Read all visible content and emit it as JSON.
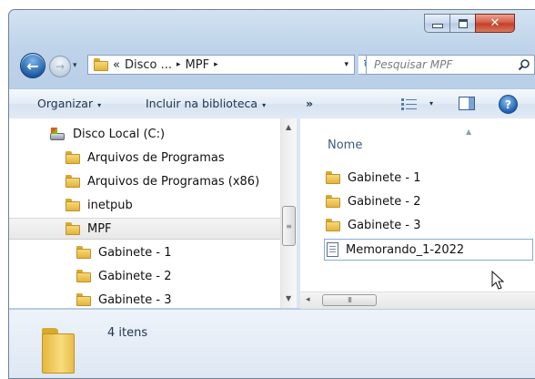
{
  "window": {
    "caption_buttons": {
      "minimize": "minimize-icon",
      "maximize": "maximize-icon",
      "close": "✕"
    }
  },
  "address_bar": {
    "overflow_marker": "«",
    "crumbs": [
      "Disco ...",
      "MPF"
    ],
    "crumb_separator": "▸",
    "dropdown_glyph": "▾"
  },
  "refresh_glyph": "↻",
  "search": {
    "placeholder": "Pesquisar MPF"
  },
  "toolbar": {
    "organize_label": "Organizar",
    "include_label": "Incluir na biblioteca",
    "more_label": "»",
    "dropdown_glyph": "▾",
    "help_glyph": "?"
  },
  "nav_tree": {
    "items": [
      {
        "label": "Disco Local (C:)",
        "icon": "drive-icon"
      },
      {
        "label": "Arquivos de Programas",
        "icon": "folder-icon"
      },
      {
        "label": "Arquivos de Programas (x86)",
        "icon": "folder-icon"
      },
      {
        "label": "inetpub",
        "icon": "folder-icon"
      },
      {
        "label": "MPF",
        "icon": "folder-icon",
        "selected": true
      },
      {
        "label": "Gabinete - 1",
        "icon": "folder-icon"
      },
      {
        "label": "Gabinete - 2",
        "icon": "folder-icon"
      },
      {
        "label": "Gabinete - 3",
        "icon": "folder-icon"
      }
    ]
  },
  "file_list": {
    "column_header": "Nome",
    "items": [
      {
        "label": "Gabinete - 1",
        "icon": "folder-icon"
      },
      {
        "label": "Gabinete - 2",
        "icon": "folder-icon"
      },
      {
        "label": "Gabinete - 3",
        "icon": "folder-icon"
      },
      {
        "label": "Memorando_1-2022",
        "icon": "text-document-icon",
        "focused": true
      }
    ]
  },
  "scrollbars": {
    "thumb_grip": "≡",
    "h_thumb_grip": "III",
    "up": "▲",
    "down": "▼",
    "left": "◂"
  },
  "details": {
    "count_text": "4 itens"
  },
  "colors": {
    "accent": "#2b6fc2",
    "selection_border": "#84acdd",
    "folder": "#e4b43a",
    "close": "#c13e27"
  }
}
